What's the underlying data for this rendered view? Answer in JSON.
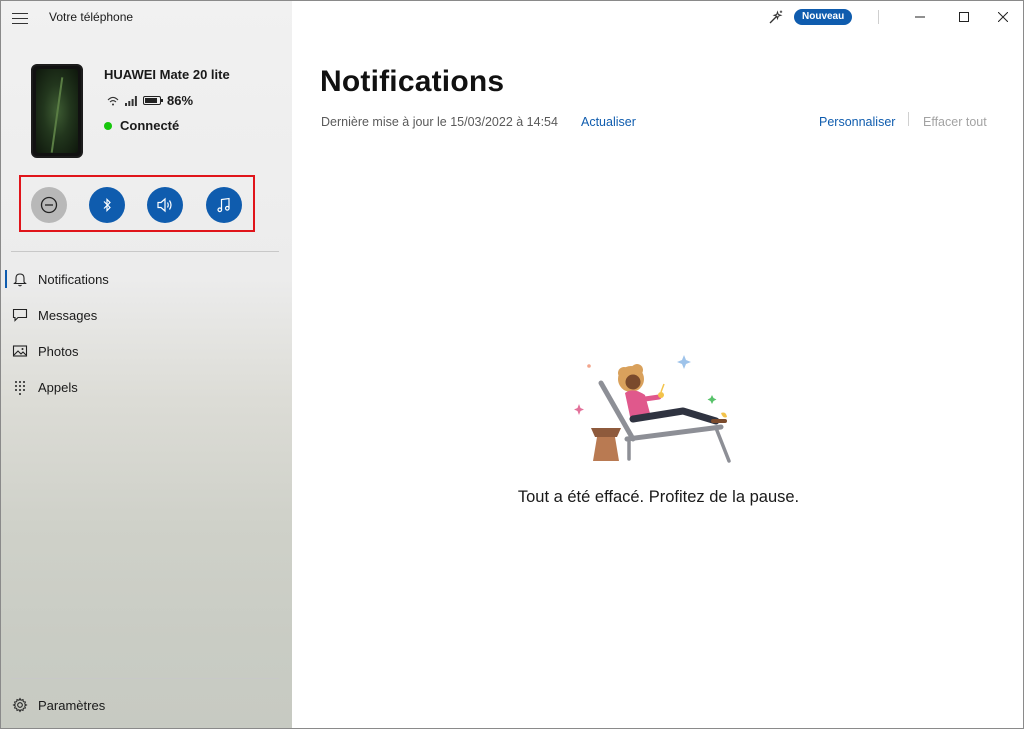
{
  "window": {
    "title": "Votre téléphone",
    "new_badge": "Nouveau"
  },
  "device": {
    "name": "HUAWEI Mate 20 lite",
    "battery": "86%",
    "battery_level": 0.86,
    "connection": "Connecté"
  },
  "quick_actions": [
    {
      "name": "do-not-disturb",
      "icon": "minus-circle-icon",
      "active": false
    },
    {
      "name": "bluetooth",
      "icon": "bluetooth-icon",
      "active": true
    },
    {
      "name": "sound",
      "icon": "speaker-icon",
      "active": true
    },
    {
      "name": "music",
      "icon": "music-note-icon",
      "active": true
    }
  ],
  "nav": {
    "items": [
      {
        "label": "Notifications",
        "icon": "bell-icon",
        "active": true
      },
      {
        "label": "Messages",
        "icon": "chat-bubble-icon",
        "active": false
      },
      {
        "label": "Photos",
        "icon": "image-icon",
        "active": false
      },
      {
        "label": "Appels",
        "icon": "dialpad-icon",
        "active": false
      }
    ],
    "settings": "Paramètres"
  },
  "main": {
    "title": "Notifications",
    "last_update": "Dernière mise à jour le 15/03/2022 à 14:54",
    "refresh": "Actualiser",
    "customize": "Personnaliser",
    "clear_all": "Effacer tout",
    "empty_message": "Tout a été effacé. Profitez de la pause."
  },
  "colors": {
    "accent": "#0f5cae",
    "highlight_box": "#e0141a",
    "connected": "#16c60c"
  }
}
